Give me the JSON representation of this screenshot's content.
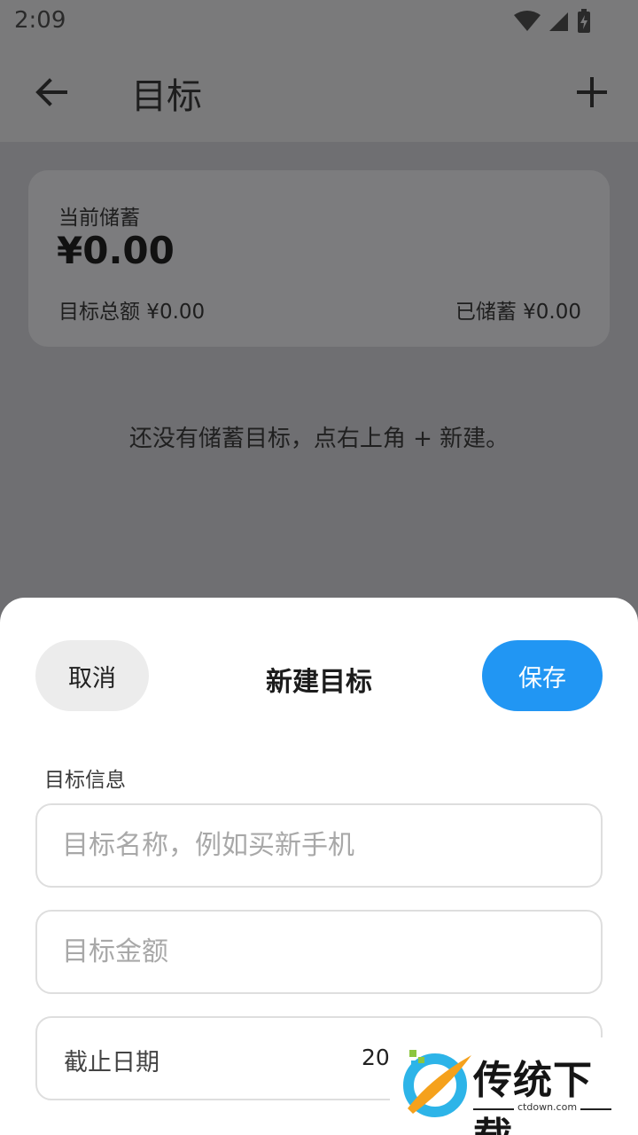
{
  "status_bar": {
    "time": "2:09"
  },
  "appbar": {
    "title": "目标"
  },
  "summary_card": {
    "label": "当前储蓄",
    "amount": "¥0.00",
    "target_total": "目标总额 ¥0.00",
    "saved": "已储蓄 ¥0.00"
  },
  "empty_state": "还没有储蓄目标，点右上角 + 新建。",
  "sheet": {
    "cancel_label": "取消",
    "title": "新建目标",
    "save_label": "保存",
    "section_label": "目标信息",
    "name_placeholder": "目标名称，例如买新手机",
    "amount_placeholder": "目标金额",
    "date_label": "截止日期",
    "date_value": "20"
  },
  "watermark": {
    "text": "传统下载",
    "domain": "ctdown.com"
  },
  "colors": {
    "primary": "#2196f3",
    "sheet_bg": "#ffffff",
    "scrim": "#6f6f72"
  }
}
